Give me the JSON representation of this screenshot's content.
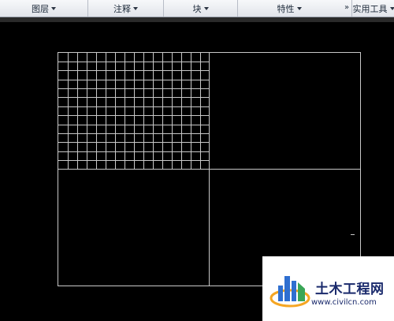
{
  "ribbon": {
    "panels": [
      {
        "label": "图层"
      },
      {
        "label": "注释"
      },
      {
        "label": "块"
      },
      {
        "label": "特性"
      }
    ],
    "overflow_glyph": "»",
    "utility_label": "实用工具"
  },
  "drawing": {
    "line_color": "#c8c8c8",
    "background": "#000000",
    "grid_columns": 16,
    "grid_rows": 13
  },
  "watermark": {
    "site_name": "土木工程网",
    "url": "www.civilcn.com",
    "brand_colors": [
      "#1a2a6c",
      "#f5a623",
      "#2f6fd0",
      "#3aa657"
    ]
  }
}
